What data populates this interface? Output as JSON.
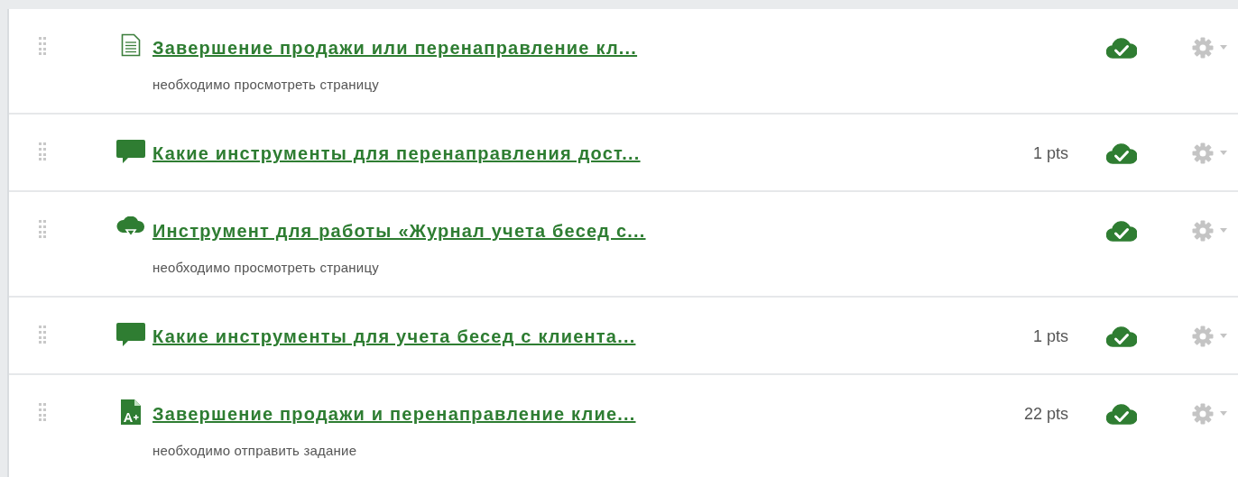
{
  "items": [
    {
      "kind": "page",
      "title": "Завершение продажи или перенаправление кл...",
      "requirement": "необходимо просмотреть страницу",
      "published": true
    },
    {
      "kind": "discussion",
      "title": "Какие инструменты для перенаправления дост...",
      "points": "1 pts",
      "published": true
    },
    {
      "kind": "file",
      "title": "Инструмент для работы «Журнал учета бесед с...",
      "requirement": "необходимо просмотреть страницу",
      "published": true
    },
    {
      "kind": "discussion",
      "title": "Какие инструменты для учета бесед с клиента...",
      "points": "1 pts",
      "published": true
    },
    {
      "kind": "assignment",
      "title": "Завершение продажи и перенаправление клие...",
      "requirement": "необходимо отправить задание",
      "points": "22 pts",
      "published": true
    }
  ]
}
